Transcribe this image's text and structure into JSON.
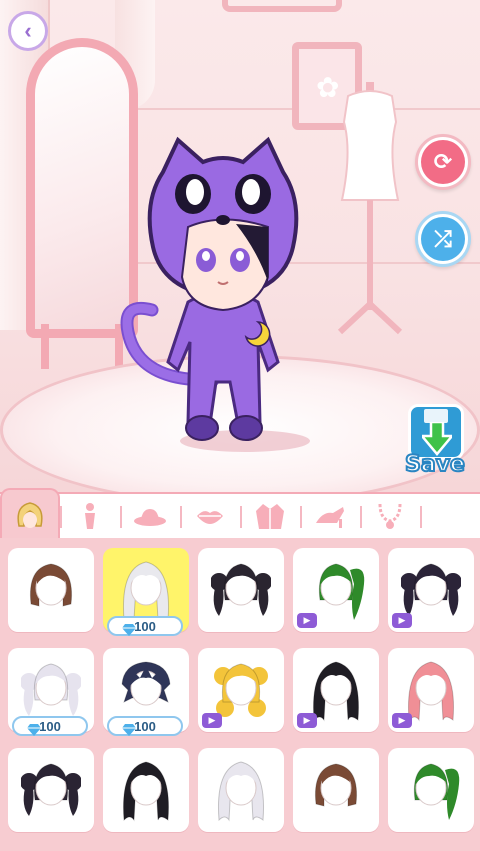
{
  "header": {
    "back_icon": "chevron-left-icon"
  },
  "actions": {
    "reset_icon": "refresh-icon",
    "shuffle_icon": "shuffle-icon",
    "save_label": "Save",
    "save_icon": "floppy-download-icon"
  },
  "colors": {
    "accent_pink": "#f4aab6",
    "panel": "#f7ccd1",
    "selected": "#fff46a",
    "save_blue": "#2f9bd5"
  },
  "character": {
    "outfit": "purple cat hood onesie with moon emblem"
  },
  "categories": [
    {
      "id": "hair",
      "icon": "hair-icon",
      "active": true
    },
    {
      "id": "body",
      "icon": "body-icon",
      "active": false
    },
    {
      "id": "hat",
      "icon": "hat-icon",
      "active": false
    },
    {
      "id": "lips",
      "icon": "lips-icon",
      "active": false
    },
    {
      "id": "coat",
      "icon": "coat-icon",
      "active": false
    },
    {
      "id": "shoes",
      "icon": "shoe-icon",
      "active": false
    },
    {
      "id": "necklace",
      "icon": "necklace-icon",
      "active": false
    },
    {
      "id": "more",
      "icon": "more-icon",
      "active": false
    }
  ],
  "items": [
    {
      "color": "#7a4a35",
      "style": "bob",
      "price": null,
      "ad": false,
      "selected": false
    },
    {
      "color": "#e9e9ee",
      "style": "long",
      "price": "100",
      "ad": false,
      "selected": true
    },
    {
      "color": "#2a2530",
      "style": "twin-curls",
      "price": null,
      "ad": false,
      "selected": false
    },
    {
      "color": "#2f8a2a",
      "style": "side-tail",
      "price": null,
      "ad": true,
      "selected": false
    },
    {
      "color": "#2b2438",
      "style": "twin-tails",
      "price": null,
      "ad": true,
      "selected": false
    },
    {
      "color": "#e6e3ee",
      "style": "twin-tails",
      "price": "100",
      "ad": false,
      "selected": false
    },
    {
      "color": "#2f3558",
      "style": "messy",
      "price": "100",
      "ad": false,
      "selected": false
    },
    {
      "color": "#f3c43a",
      "style": "curly-buns",
      "price": null,
      "ad": true,
      "selected": false
    },
    {
      "color": "#1f1d24",
      "style": "long",
      "price": null,
      "ad": true,
      "selected": false
    },
    {
      "color": "#f08f96",
      "style": "long-wavy",
      "price": null,
      "ad": true,
      "selected": false
    },
    {
      "color": "#2a2433",
      "style": "twin-tails",
      "price": null,
      "ad": false,
      "selected": false
    },
    {
      "color": "#1f1d24",
      "style": "long",
      "price": null,
      "ad": false,
      "selected": false
    },
    {
      "color": "#e8e6ee",
      "style": "long",
      "price": null,
      "ad": false,
      "selected": false
    },
    {
      "color": "#7a4a35",
      "style": "bob",
      "price": null,
      "ad": false,
      "selected": false
    },
    {
      "color": "#2f8a2a",
      "style": "side-tail",
      "price": null,
      "ad": false,
      "selected": false
    }
  ]
}
